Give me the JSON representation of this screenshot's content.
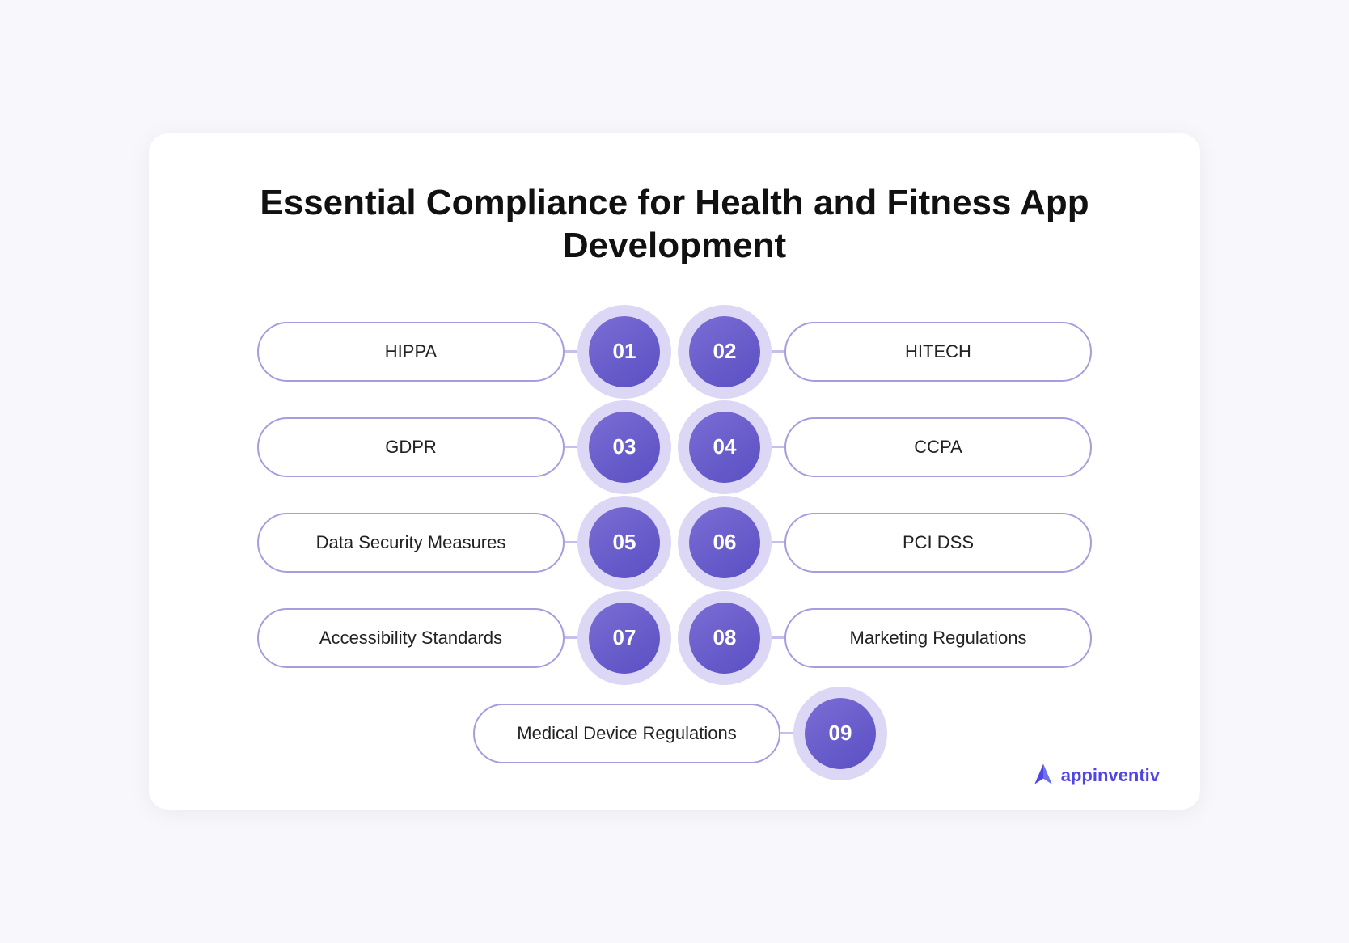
{
  "title": {
    "line1": "Essential Compliance for Health and Fitness App",
    "line2": "Development"
  },
  "rows": [
    {
      "left": {
        "label": "HIPPA",
        "num": "01"
      },
      "right": {
        "label": "HITECH",
        "num": "02"
      }
    },
    {
      "left": {
        "label": "GDPR",
        "num": "03"
      },
      "right": {
        "label": "CCPA",
        "num": "04"
      }
    },
    {
      "left": {
        "label": "Data Security Measures",
        "num": "05"
      },
      "right": {
        "label": "PCI DSS",
        "num": "06"
      }
    },
    {
      "left": {
        "label": "Accessibility Standards",
        "num": "07"
      },
      "right": {
        "label": "Marketing Regulations",
        "num": "08"
      }
    },
    {
      "left": {
        "label": "Medical Device Regulations",
        "num": "09"
      },
      "right": null
    }
  ],
  "logo": {
    "name": "appinventiv",
    "display": "appinventiv"
  }
}
